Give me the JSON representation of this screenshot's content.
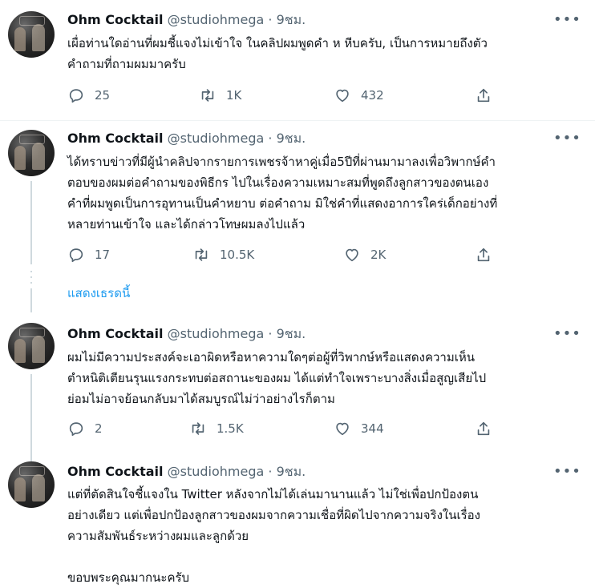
{
  "tweets": [
    {
      "name": "Ohm Cocktail",
      "handle": "@studiohmega",
      "time": "9ชม.",
      "lines": [
        "เผื่อท่านใดอ่านที่ผมชี้แจงไม่เข้าใจ  ในคลิปผมพูดคำ ห หีบครับ, เป็นการหมายถึงตัว",
        "คำถามที่ถามผมมาครับ"
      ],
      "reply": "25",
      "retweet": "1K",
      "like": "432"
    },
    {
      "name": "Ohm Cocktail",
      "handle": "@studiohmega",
      "time": "9ชม.",
      "lines": [
        "ได้ทราบข่าวที่มีผู้นำคลิปจากรายการเพชรจ้าหาคู่เมื่อ5ปีที่ผ่านมามาลงเพื่อวิพากษ์คำ",
        "ตอบของผมต่อคำถามของพิธีกร ไปในเรื่องความเหมาะสมที่พูดถึงลูกสาวของตนเอง",
        "คำที่ผมพูดเป็นการอุทานเป็นคำหยาบ ต่อคำถาม มิใช่คำที่แสดงอาการใคร่เด็กอย่างที่",
        "หลายท่านเข้าใจ และได้กล่าวโทษผมลงไปแล้ว"
      ],
      "reply": "17",
      "retweet": "10.5K",
      "like": "2K"
    },
    {
      "name": "Ohm Cocktail",
      "handle": "@studiohmega",
      "time": "9ชม.",
      "lines": [
        "ผมไม่มีความประสงค์จะเอาผิดหรือหาความใดๆต่อผู้ที่วิพากษ์หรือแสดงความเห็น",
        "ตำหนิติเตียนรุนแรงกระทบต่อสถานะของผม ได้แต่ทำใจเพราะบางสิ่งเมื่อสูญเสียไป",
        "ย่อมไม่อาจย้อนกลับมาได้สมบูรณ์ไม่ว่าอย่างไรก็ตาม"
      ],
      "reply": "2",
      "retweet": "1.5K",
      "like": "344"
    },
    {
      "name": "Ohm Cocktail",
      "handle": "@studiohmega",
      "time": "9ชม.",
      "lines": [
        "แต่ที่ตัดสินใจชี้แจงใน Twitter หลังจากไม่ได้เล่นมานานแล้ว ไม่ใช่เพื่อปกป้องตน",
        "อย่างเดียว แต่เพื่อปกป้องลูกสาวของผมจากความเชื่อที่ผิดไปจากความจริงในเรื่อง",
        "ความสัมพันธ์ระหว่างผมและลูกด้วย",
        "",
        "ขอบพระคุณมากนะครับ"
      ]
    }
  ],
  "show_thread_label": "แสดงเธรดนี้",
  "separator": "·",
  "colors": {
    "accent": "#1d9bf0",
    "muted": "#536471",
    "text": "#0f1419"
  }
}
